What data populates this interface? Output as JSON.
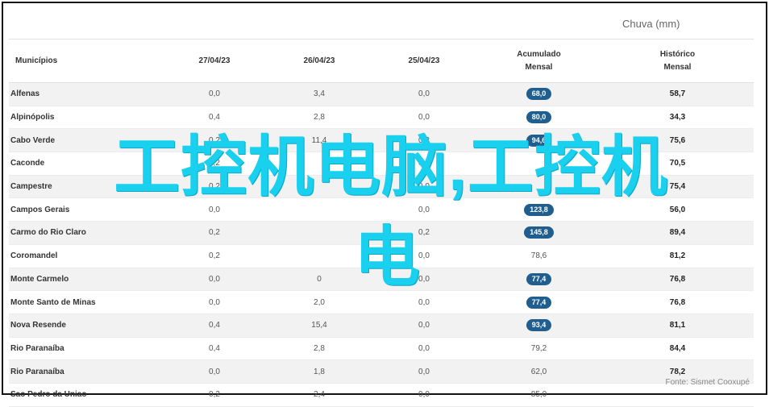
{
  "unit_label": "Chuva (mm)",
  "headers": {
    "municipio": "Municípios",
    "d1": "27/04/23",
    "d2": "26/04/23",
    "d3": "25/04/23",
    "acum_line1": "Acumulado",
    "acum_line2": "Mensal",
    "hist_line1": "Histórico",
    "hist_line2": "Mensal"
  },
  "rows": [
    {
      "name": "Alfenas",
      "d1": "0,0",
      "d2": "3,4",
      "d3": "0,0",
      "acum": "68,0",
      "acum_pill": true,
      "hist": "58,7"
    },
    {
      "name": "Alpinópolis",
      "d1": "0,4",
      "d2": "2,8",
      "d3": "0,0",
      "acum": "80,0",
      "acum_pill": true,
      "hist": "34,3"
    },
    {
      "name": "Cabo Verde",
      "d1": "0,2",
      "d2": "11,4",
      "d3": "0,2",
      "acum": "94,6",
      "acum_pill": true,
      "hist": "75,6"
    },
    {
      "name": "Caconde",
      "d1": "0,2",
      "d2": "",
      "d3": "0,0",
      "acum": "",
      "acum_pill": true,
      "hist": "70,5"
    },
    {
      "name": "Campestre",
      "d1": "0,2",
      "d2": "",
      "d3": "0,0",
      "acum": "",
      "acum_pill": false,
      "hist": "75,4"
    },
    {
      "name": "Campos Gerais",
      "d1": "0,0",
      "d2": "",
      "d3": "0,0",
      "acum": "123,8",
      "acum_pill": true,
      "hist": "56,0"
    },
    {
      "name": "Carmo do Rio Claro",
      "d1": "0,2",
      "d2": "",
      "d3": "0,2",
      "acum": "145,8",
      "acum_pill": true,
      "hist": "89,4"
    },
    {
      "name": "Coromandel",
      "d1": "0,2",
      "d2": "",
      "d3": "0,0",
      "acum": "78,6",
      "acum_pill": false,
      "hist": "81,2"
    },
    {
      "name": "Monte Carmelo",
      "d1": "0,0",
      "d2": "0",
      "d3": "0,0",
      "acum": "77,4",
      "acum_pill": true,
      "hist": "76,8"
    },
    {
      "name": "Monte Santo de Minas",
      "d1": "0,0",
      "d2": "2,0",
      "d3": "0,0",
      "acum": "77,4",
      "acum_pill": true,
      "hist": "76,8"
    },
    {
      "name": "Nova Resende",
      "d1": "0,4",
      "d2": "15,4",
      "d3": "0,0",
      "acum": "93,4",
      "acum_pill": true,
      "hist": "81,1"
    },
    {
      "name": "Rio Paranaíba",
      "d1": "0,4",
      "d2": "2,8",
      "d3": "0,0",
      "acum": "79,2",
      "acum_pill": false,
      "hist": "84,4"
    },
    {
      "name": "Rio Paranaíba",
      "d1": "0,0",
      "d2": "1,8",
      "d3": "0,0",
      "acum": "62,0",
      "acum_pill": false,
      "hist": "78,2"
    },
    {
      "name": "Sao Pedro da Uniao",
      "d1": "0,2",
      "d2": "2,4",
      "d3": "0,0",
      "acum": "85,0",
      "acum_pill": false,
      "hist": ""
    }
  ],
  "source": "Fonte: Sismet Cooxupé",
  "overlay": {
    "line1": "工控机电脑,工控机",
    "line2": "电"
  }
}
